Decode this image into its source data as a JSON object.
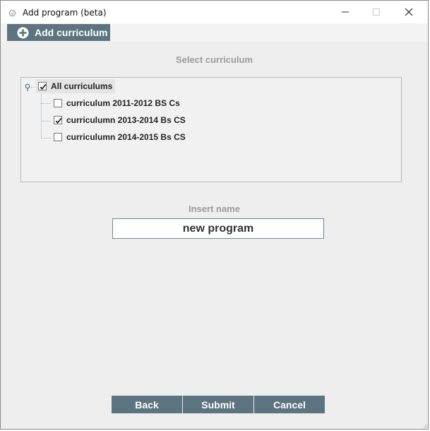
{
  "window": {
    "title": "Add program (beta)"
  },
  "toolbar": {
    "add_curriculum_label": "Add curriculum",
    "add_icon": "plus-circle-icon"
  },
  "colors": {
    "accent": "#5b7480",
    "label_gray": "#9a9a9a",
    "window_bg": "#eeeeee"
  },
  "select_section": {
    "label": "Select curriculum",
    "tree": {
      "root": {
        "label": "All curriculums",
        "checked": true,
        "expanded": true
      },
      "items": [
        {
          "label": "curriculum 2011-2012 BS Cs",
          "checked": false
        },
        {
          "label": "curriculumn 2013-2014 Bs CS",
          "checked": true
        },
        {
          "label": "curriculumn 2014-2015 Bs CS",
          "checked": false
        }
      ]
    }
  },
  "name_section": {
    "label": "Insert name",
    "value": "new program"
  },
  "buttons": {
    "back": "Back",
    "submit": "Submit",
    "cancel": "Cancel"
  }
}
